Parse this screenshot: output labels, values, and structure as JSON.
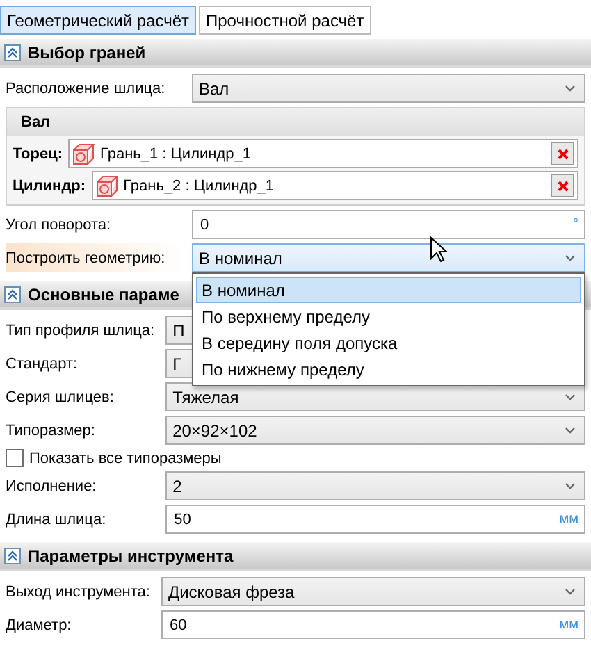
{
  "tabs": [
    {
      "label": "Геометрический расчёт",
      "selected": true
    },
    {
      "label": "Прочностной расчёт",
      "selected": false
    }
  ],
  "sections": [
    {
      "title": "Выбор граней",
      "expanded": true,
      "rows": [
        {
          "kind": "select",
          "label": "Расположение шлица:",
          "value": "Вал"
        },
        {
          "kind": "group",
          "title": "Вал",
          "faces": [
            {
              "label": "Торец:",
              "value": "Грань_1 : Цилиндр_1"
            },
            {
              "label": "Цилиндр:",
              "value": "Грань_2 : Цилиндр_1"
            }
          ]
        },
        {
          "kind": "number",
          "label": "Угол поворота:",
          "value": "0",
          "unit": "°"
        },
        {
          "kind": "select",
          "label": "Построить геометрию:",
          "value": "В номинал",
          "focused": true,
          "dropdown": [
            {
              "label": "В номинал",
              "selected": true
            },
            {
              "label": "По верхнему пределу",
              "selected": false
            },
            {
              "label": "В середину поля допуска",
              "selected": false
            },
            {
              "label": "По нижнему пределу",
              "selected": false
            }
          ]
        }
      ]
    },
    {
      "title": "Основные параме",
      "expanded": true,
      "rows": [
        {
          "kind": "select",
          "label": "Тип профиля шлица:",
          "value": "П",
          "covered": true
        },
        {
          "kind": "select",
          "label": "Стандарт:",
          "value": "Г",
          "covered": true
        },
        {
          "kind": "select",
          "label": "Серия шлицев:",
          "value": "Тяжелая"
        },
        {
          "kind": "select",
          "label": "Типоразмер:",
          "value": "20×92×102"
        },
        {
          "kind": "checkbox",
          "label": "Показать все типоразмеры",
          "checked": false
        },
        {
          "kind": "select",
          "label": "Исполнение:",
          "value": "2"
        },
        {
          "kind": "number",
          "label": "Длина шлица:",
          "value": "50",
          "unit": "мм"
        }
      ]
    },
    {
      "title": "Параметры инструмента",
      "expanded": true,
      "rows": [
        {
          "kind": "select",
          "label": "Выход инструмента:",
          "value": "Дисковая фреза"
        },
        {
          "kind": "number",
          "label": "Диаметр:",
          "value": "60",
          "unit": "мм"
        }
      ]
    }
  ]
}
